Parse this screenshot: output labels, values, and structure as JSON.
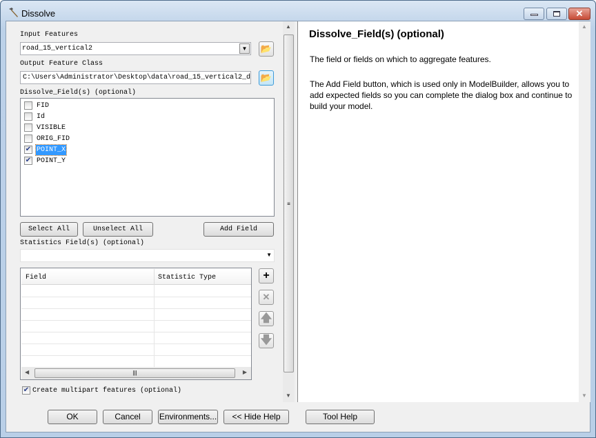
{
  "window": {
    "title": "Dissolve",
    "icon": "hammer-icon"
  },
  "form": {
    "input_features_label": "Input Features",
    "input_features_value": "road_15_vertical2",
    "output_label": "Output Feature Class",
    "output_value": "C:\\Users\\Administrator\\Desktop\\data\\road_15_vertical2_d",
    "dissolve_label": "Dissolve_Field(s) (optional)",
    "fields": [
      {
        "name": "FID",
        "checked": false
      },
      {
        "name": "Id",
        "checked": false
      },
      {
        "name": "VISIBLE",
        "checked": false
      },
      {
        "name": "ORIG_FID",
        "checked": false
      },
      {
        "name": "POINT_X",
        "checked": true,
        "selected": true
      },
      {
        "name": "POINT_Y",
        "checked": true
      }
    ],
    "select_all": "Select All",
    "unselect_all": "Unselect All",
    "add_field": "Add Field",
    "stats_label": "Statistics Field(s) (optional)",
    "stats_value": "",
    "table_headers": [
      "Field",
      "Statistic Type"
    ],
    "multipart_label": "Create multipart features (optional)",
    "multipart_checked": true
  },
  "help": {
    "title": "Dissolve_Field(s) (optional)",
    "p1": "The field or fields on which to aggregate features.",
    "p2": "The Add Field button, which is used only in ModelBuilder, allows you to add expected fields so you can complete the dialog box and continue to build your model."
  },
  "buttons": {
    "ok": "OK",
    "cancel": "Cancel",
    "environments": "Environments...",
    "hide_help": "<< Hide Help",
    "tool_help": "Tool Help"
  }
}
